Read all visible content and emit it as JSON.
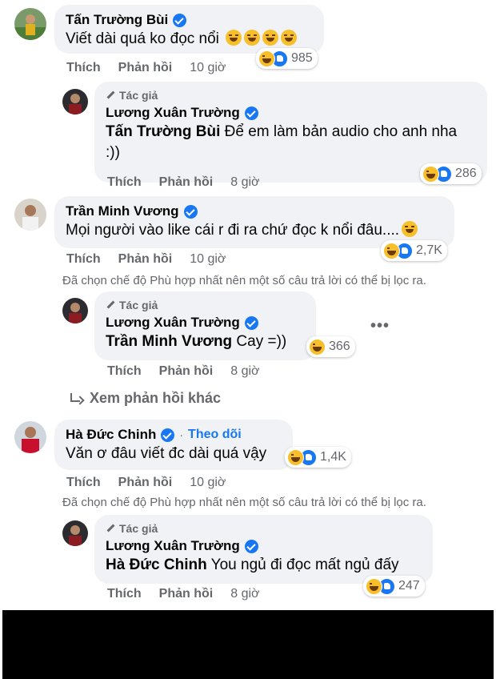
{
  "actions": {
    "like": "Thích",
    "reply": "Phản hồi"
  },
  "author_badge": "Tác giả",
  "filter_note": "Đã chọn chế độ Phù hợp nhất nên một số câu trả lời có thể bị lọc ra.",
  "more_replies": "Xem phản hồi khác",
  "follow_label": "Theo dõi",
  "follow_separator": "·",
  "more_options": "•••",
  "colors": {
    "accent": "#1877f2",
    "bubble": "#f0f2f5",
    "muted": "#65676b"
  },
  "comments": [
    {
      "name": "Tấn Trường Bùi",
      "text": "Viết dài quá ko đọc nổi",
      "time": "10 giờ",
      "reactions": "985"
    },
    {
      "name": "Lương Xuân Trường",
      "mention": "Tấn Trường Bùi",
      "text": " Để em làm bản audio cho anh nha :))",
      "time": "8 giờ",
      "reactions": "286"
    },
    {
      "name": "Trần Minh Vương",
      "text": "Mọi người vào like cái r đi ra chứ đọc k nổi đâu....",
      "time": "10 giờ",
      "reactions": "2,7K"
    },
    {
      "name": "Lương Xuân Trường",
      "mention": "Trần Minh Vương",
      "text": " Cay =))",
      "time": "8 giờ",
      "reactions": "366"
    },
    {
      "name": "Hà Đức Chinh",
      "text": "Văn ơ đâu viết đc dài quá vậy",
      "time": "10 giờ",
      "reactions": "1,4K"
    },
    {
      "name": "Lương Xuân Trường",
      "mention": "Hà Đức Chinh",
      "text": " You ngủ đi đọc mất ngủ đấy",
      "time": "8 giờ",
      "reactions": "247"
    }
  ]
}
